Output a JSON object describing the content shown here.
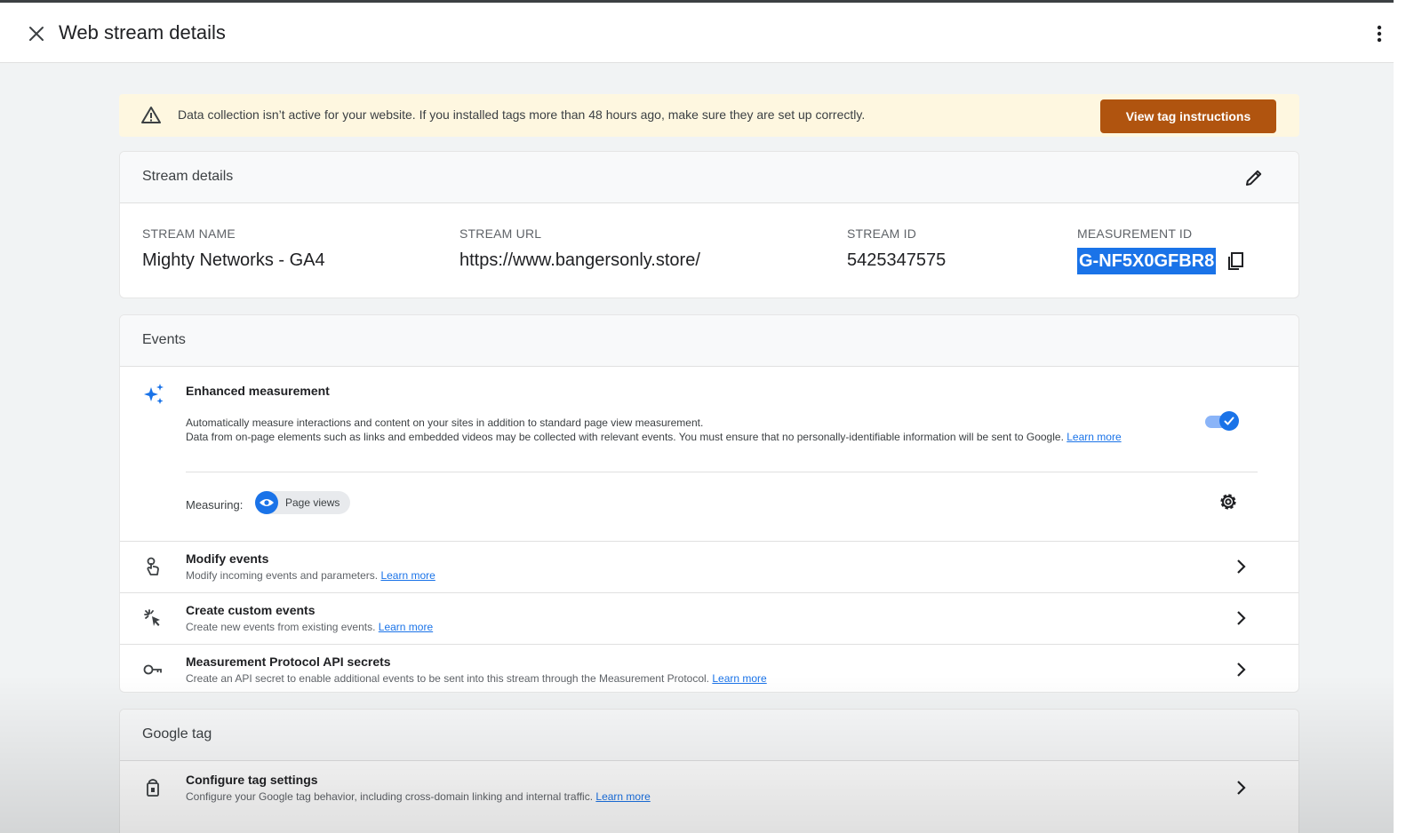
{
  "header": {
    "title": "Web stream details",
    "close_icon": "close-icon",
    "more_icon": "more-vert-icon"
  },
  "banner": {
    "icon": "warning-icon",
    "message": "Data collection isn’t active for your website. If you installed tags more than 48 hours ago, make sure they are set up correctly.",
    "button_label": "View tag instructions",
    "button_color": "#b0540f"
  },
  "stream_details": {
    "title": "Stream details",
    "edit_icon": "pencil-icon",
    "stream_name_label": "STREAM NAME",
    "stream_name": "Mighty Networks - GA4",
    "stream_url_label": "STREAM URL",
    "stream_url": "https://www.bangersonly.store/",
    "stream_id_label": "STREAM ID",
    "stream_id": "5425347575",
    "measurement_id_label": "MEASUREMENT ID",
    "measurement_id": "G-NF5X0GFBR8",
    "copy_icon": "copy-icon"
  },
  "events": {
    "title": "Events",
    "enhanced": {
      "icon": "sparkle-icon",
      "title": "Enhanced measurement",
      "desc_line1": "Automatically measure interactions and content on your sites in addition to standard page view measurement.",
      "desc_line2": "Data from on-page elements such as links and embedded videos may be collected with relevant events. You must ensure that no personally-identifiable information will be sent to Google.",
      "learn_more": "Learn more",
      "enabled": true,
      "measuring_label": "Measuring:",
      "chip_label": "Page views",
      "chip_icon": "eye-icon",
      "settings_icon": "gear-icon"
    },
    "rows": [
      {
        "icon": "touch-icon",
        "title": "Modify events",
        "subtitle": "Modify incoming events and parameters.",
        "link": "Learn more"
      },
      {
        "icon": "click-sparkle-icon",
        "title": "Create custom events",
        "subtitle": "Create new events from existing events.",
        "link": "Learn more"
      },
      {
        "icon": "key-icon",
        "title": "Measurement Protocol API secrets",
        "subtitle": "Create an API secret to enable additional events to be sent into this stream through the Measurement Protocol.",
        "link": "Learn more"
      }
    ]
  },
  "google_tag": {
    "title": "Google tag",
    "rows": [
      {
        "icon": "tag-icon",
        "title": "Configure tag settings",
        "subtitle": "Configure your Google tag behavior, including cross-domain linking and internal traffic.",
        "link": "Learn more"
      }
    ]
  },
  "colors": {
    "accent": "#1a73e8",
    "banner_bg": "#fef7e0",
    "page_bg": "#f1f3f4"
  }
}
